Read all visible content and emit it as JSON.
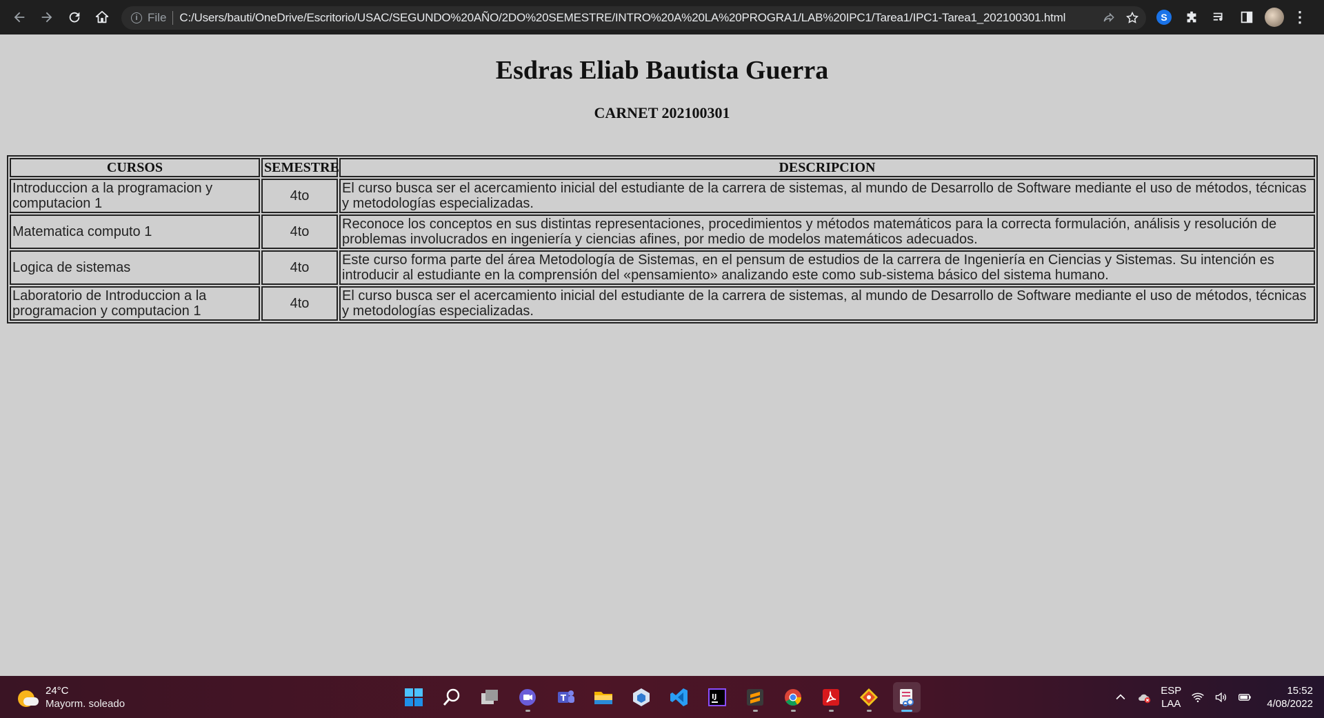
{
  "browser": {
    "url_scheme_label": "File",
    "url": "C:/Users/bauti/OneDrive/Escritorio/USAC/SEGUNDO%20AÑO/2DO%20SEMESTRE/INTRO%20A%20LA%20PROGRA1/LAB%20IPC1/Tarea1/IPC1-Tarea1_202100301.html",
    "theme": {
      "toolbar_bg": "#1f1f1f",
      "omnibox_bg": "#2c2c2c"
    }
  },
  "page": {
    "title": "Esdras Eliab Bautista Guerra",
    "subtitle": "CARNET 202100301",
    "background": "#cfcfcf",
    "table": {
      "headers": [
        "CURSOS",
        "SEMESTRE",
        "DESCRIPCION"
      ],
      "rows": [
        {
          "curso": "Introduccion a la programacion y computacion 1",
          "semestre": "4to",
          "descripcion": "El curso busca ser el acercamiento inicial del estudiante de la carrera de sistemas, al mundo de Desarrollo de Software mediante el uso de métodos, técnicas y metodologías especializadas."
        },
        {
          "curso": "Matematica computo 1",
          "semestre": "4to",
          "descripcion": "Reconoce los conceptos en sus distintas representaciones, procedimientos y métodos matemáticos para la correcta formulación, análisis y resolución de problemas involucrados en ingeniería y ciencias afines, por medio de modelos matemáticos adecuados."
        },
        {
          "curso": "Logica de sistemas",
          "semestre": "4to",
          "descripcion": "Este curso forma parte del área Metodología de Sistemas, en el pensum de estudios de la carrera de Ingeniería en Ciencias y Sistemas. Su intención es introducir al estudiante en la comprensión del «pensamiento» analizando este como sub-sistema básico del sistema humano."
        },
        {
          "curso": "Laboratorio de Introduccion a la programacion y computacion 1",
          "semestre": "4to",
          "descripcion": "El curso busca ser el acercamiento inicial del estudiante de la carrera de sistemas, al mundo de Desarrollo de Software mediante el uso de métodos, técnicas y metodologías especializadas."
        }
      ]
    }
  },
  "taskbar": {
    "weather": {
      "temp": "24°C",
      "condition": "Mayorm. soleado"
    },
    "apps": [
      {
        "name": "start",
        "icon": "windows-icon"
      },
      {
        "name": "search",
        "icon": "search-icon"
      },
      {
        "name": "task-view",
        "icon": "task-view-icon"
      },
      {
        "name": "chat",
        "icon": "chat-icon"
      },
      {
        "name": "teams",
        "icon": "teams-icon"
      },
      {
        "name": "file-explorer",
        "icon": "folder-icon"
      },
      {
        "name": "virtualbox",
        "icon": "cube-icon"
      },
      {
        "name": "vscode",
        "icon": "vscode-icon"
      },
      {
        "name": "intellij",
        "icon": "intellij-icon"
      },
      {
        "name": "sublime",
        "icon": "sublime-icon"
      },
      {
        "name": "chrome",
        "icon": "chrome-icon"
      },
      {
        "name": "acrobat",
        "icon": "pdf-icon"
      },
      {
        "name": "git",
        "icon": "git-icon"
      },
      {
        "name": "snipping-tool",
        "icon": "snipping-icon"
      }
    ],
    "tray": {
      "lang_top": "ESP",
      "lang_bottom": "LAA",
      "time": "15:52",
      "date": "4/08/2022"
    },
    "accent": "#5cc1ff"
  }
}
